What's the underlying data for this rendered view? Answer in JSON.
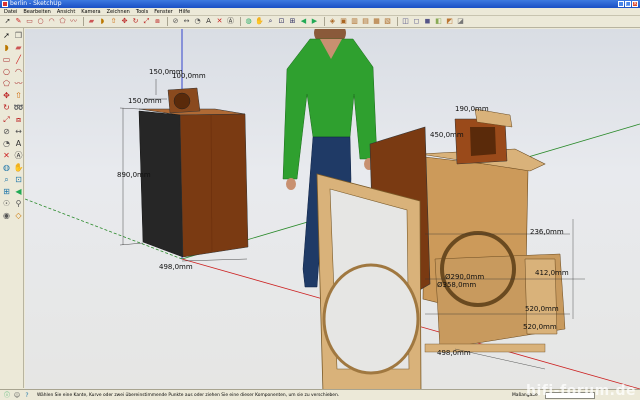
{
  "window": {
    "title": "berlin - SketchUp"
  },
  "menu": [
    "Datei",
    "Bearbeiten",
    "Ansicht",
    "Kamera",
    "Zeichnen",
    "Tools",
    "Fenster",
    "Hilfe"
  ],
  "toolbar": {
    "icons": [
      "select-icon",
      "pencil-icon",
      "rectangle-icon",
      "circle-icon",
      "arc-icon",
      "polygon-icon",
      "freehand-icon",
      "eraser-icon",
      "paint-bucket-icon",
      "push-pull-icon",
      "move-icon",
      "rotate-icon",
      "scale-icon",
      "offset-icon",
      "tape-measure-icon",
      "dimension-icon",
      "protractor-icon",
      "text-icon",
      "axes-icon",
      "3d-text-icon",
      "orbit-icon",
      "pan-icon",
      "zoom-icon",
      "zoom-window-icon",
      "zoom-extents-icon",
      "previous-view-icon",
      "next-view-icon",
      "iso-view-icon",
      "top-view-icon",
      "front-view-icon",
      "right-view-icon",
      "back-view-icon",
      "left-view-icon",
      "xray-icon",
      "wireframe-icon",
      "hidden-line-icon",
      "shaded-icon",
      "shaded-texture-icon",
      "monochrome-icon"
    ]
  },
  "viewport": {
    "dimensions_left_box": {
      "width_top_a": "150,0mm",
      "width_top_b": "100,0mm",
      "depth_side": "150,0mm",
      "height": "890,0mm",
      "width_bottom": "498,0mm"
    },
    "dimensions_right_box": {
      "top_width": "190,0mm",
      "top_depth": "450,0mm",
      "right_a": "236,0mm",
      "right_b": "412,0mm",
      "center_a": "Ø290,0mm",
      "center_b": "Ø358,0mm",
      "bottom_a": "520,0mm",
      "bottom_b": "498,0mm",
      "bottom_c": "520,0mm"
    }
  },
  "statusbar": {
    "hint": "Wählen Sie eine Kante, Kurve oder zwei übereinstimmende Punkte aus oder ziehen Sie eine dieser Komponenten, um sie zu verschieben.",
    "vcb_label": "Maßangabe"
  },
  "watermark": "hifi-forum.de",
  "colors": {
    "wood_dark": "#7a3a12",
    "wood_side": "#9a4a1a",
    "chipboard": "#d9b27a",
    "fabric": "#2a2a2a",
    "shirt": "#2fa02f",
    "jeans": "#1f3a66"
  }
}
